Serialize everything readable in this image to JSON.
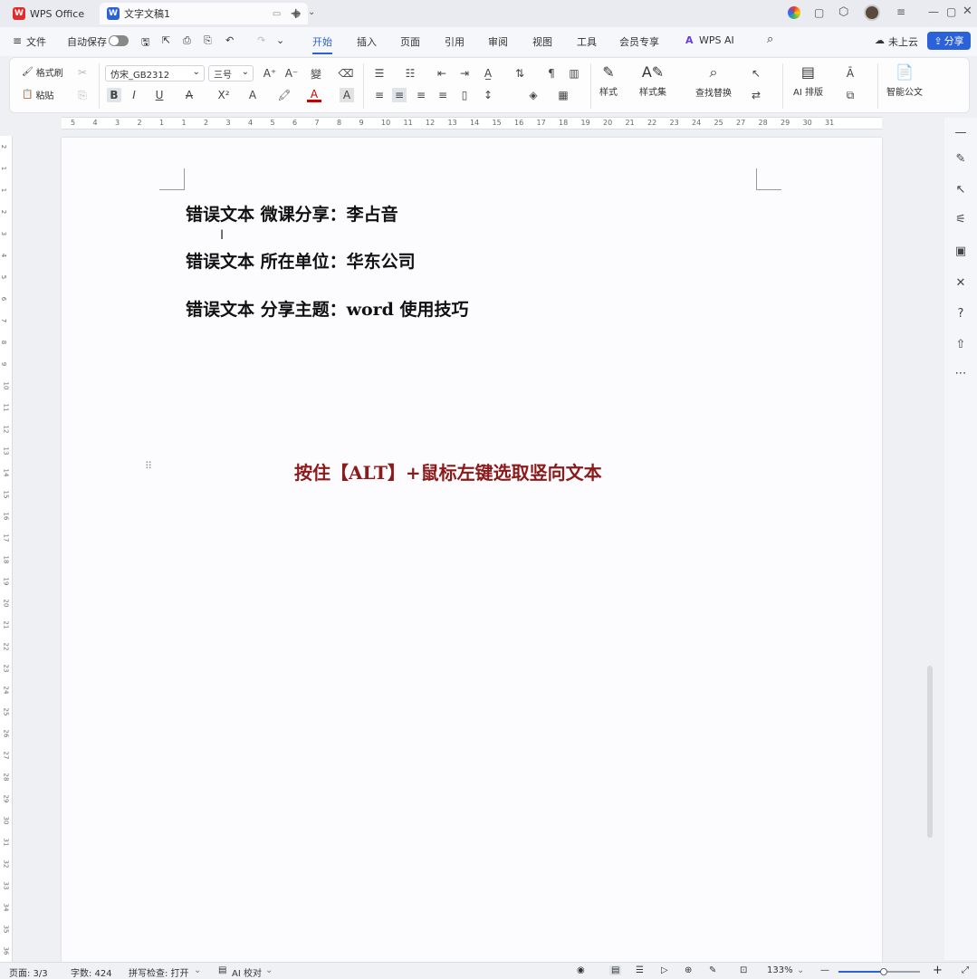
{
  "titlebar": {
    "tabs": [
      {
        "label": "WPS Office",
        "icon": "wps-logo-icon"
      },
      {
        "label": "文字文稿1",
        "icon": "word-doc-icon"
      }
    ],
    "window_controls": [
      "minimize",
      "maximize",
      "close"
    ]
  },
  "menubar": {
    "file_label": "文件",
    "autosave_label": "自动保存",
    "items": [
      "开始",
      "插入",
      "页面",
      "引用",
      "审阅",
      "视图",
      "工具",
      "会员专享"
    ],
    "active": "开始",
    "wps_ai_label": "WPS AI",
    "cloud_label": "未上云",
    "share_label": "分享"
  },
  "ribbon": {
    "format_painter": "格式刷",
    "paste": "粘贴",
    "font_name": "仿宋_GB2312",
    "font_size": "三号",
    "styles": "样式",
    "style_set": "样式集",
    "find_replace": "查找替换",
    "ai_layout": "AI 排版",
    "smart_doc": "智能公文",
    "buttons": {
      "bold": "B",
      "italic": "I",
      "underline": "U",
      "strike": "A",
      "superscript": "X²",
      "font_color": "A"
    }
  },
  "document": {
    "lines": [
      "错误文本 微课分享：李占音",
      "错误文本 所在单位：华东公司",
      "错误文本 分享主题：word 使用技巧"
    ],
    "instruction": "按住【ALT】+鼠标左键选取竖向文本",
    "instruction_color": "#8b1a1a"
  },
  "hruler_labels": [
    "5",
    "4",
    "3",
    "2",
    "1",
    "1",
    "2",
    "3",
    "4",
    "5",
    "6",
    "7",
    "8",
    "9",
    "10",
    "11",
    "12",
    "13",
    "14",
    "15",
    "16",
    "17",
    "18",
    "19",
    "20",
    "21",
    "22",
    "23",
    "24",
    "25",
    "27",
    "28",
    "29",
    "30",
    "31"
  ],
  "vruler_labels": [
    "2",
    "1",
    "1",
    "2",
    "3",
    "4",
    "5",
    "6",
    "7",
    "8",
    "9",
    "10",
    "11",
    "12",
    "13",
    "14",
    "15",
    "16",
    "17",
    "18",
    "19",
    "20",
    "21",
    "22",
    "23",
    "24",
    "25",
    "26",
    "27",
    "28",
    "29",
    "30",
    "31",
    "32",
    "33",
    "34",
    "35",
    "36"
  ],
  "statusbar": {
    "page": "页面: 3/3",
    "words": "字数: 424",
    "spell": "拼写检查: 打开",
    "ai_check": "AI 校对",
    "zoom": "133%"
  }
}
